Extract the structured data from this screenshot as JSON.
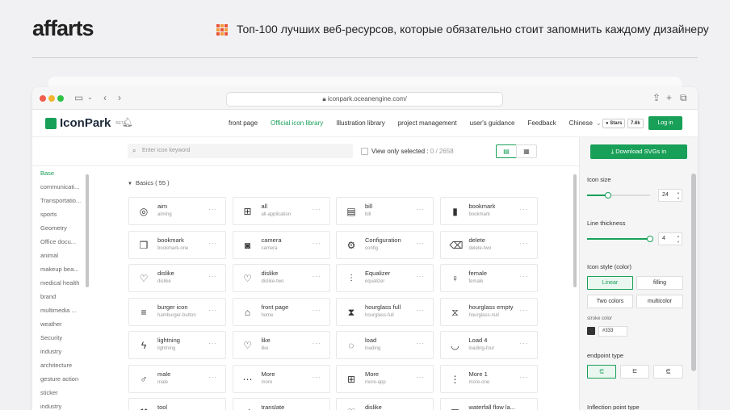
{
  "page": {
    "logo": "affarts",
    "headline": "Топ-100 лучших веб-ресурсов, которые обязательно стоит запомнить каждому дизайнеру"
  },
  "browser": {
    "url": "iconpark.oceanengine.com/"
  },
  "app": {
    "brand": "IconPark",
    "beta": "BETA",
    "nav": [
      "front page",
      "Official icon library",
      "Illustration library",
      "project management",
      "user's guidance",
      "Feedback",
      "Chinese"
    ],
    "active_nav": "Official icon library",
    "stars_label": "Stars",
    "stars_count": "7.6k",
    "login": "Log in"
  },
  "toolbar": {
    "search_placeholder": "Enter icon keyword",
    "view_only_label": "View only selected :",
    "view_only_count": "0 / 2658"
  },
  "sidebar": {
    "active": "Base",
    "items": [
      "Base",
      "communicati...",
      "Transportatio...",
      "sports",
      "Geometry",
      "Office docu...",
      "animal",
      "makeup bea...",
      "medical health",
      "brand",
      "multimedia ...",
      "weather",
      "Security",
      "industry",
      "architecture",
      "gesture action",
      "sticker",
      "industry"
    ]
  },
  "main": {
    "section_title": "Basics ( 55 )",
    "cards": [
      {
        "name": "aim",
        "sub": "aiming",
        "icon": "aim-icon",
        "glyph": "◎"
      },
      {
        "name": "all",
        "sub": "all-application",
        "icon": "all-application-icon",
        "glyph": "⊞"
      },
      {
        "name": "bill",
        "sub": "bill",
        "icon": "bill-icon",
        "glyph": "▤"
      },
      {
        "name": "bookmark",
        "sub": "bookmark",
        "icon": "bookmark-icon",
        "glyph": "▮"
      },
      {
        "name": "bookmark",
        "sub": "bookmark-one",
        "icon": "bookmark-one-icon",
        "glyph": "❒"
      },
      {
        "name": "camera",
        "sub": "camera",
        "icon": "camera-icon",
        "glyph": "◙"
      },
      {
        "name": "Configuration",
        "sub": "config",
        "icon": "config-icon",
        "glyph": "⚙"
      },
      {
        "name": "delete",
        "sub": "delete-two",
        "icon": "delete-icon",
        "glyph": "⌫"
      },
      {
        "name": "dislike",
        "sub": "dislike",
        "icon": "dislike-icon",
        "glyph": "♡"
      },
      {
        "name": "dislike",
        "sub": "dislike-two",
        "icon": "dislike-two-icon",
        "glyph": "♡"
      },
      {
        "name": "Equalizer",
        "sub": "equalizer",
        "icon": "equalizer-icon",
        "glyph": "⫶"
      },
      {
        "name": "female",
        "sub": "female",
        "icon": "female-icon",
        "glyph": "♀"
      },
      {
        "name": "burger icon",
        "sub": "hamburger-button",
        "icon": "hamburger-icon",
        "glyph": "≡"
      },
      {
        "name": "front page",
        "sub": "home",
        "icon": "home-icon",
        "glyph": "⌂"
      },
      {
        "name": "hourglass full",
        "sub": "hourglass-full",
        "icon": "hourglass-full-icon",
        "glyph": "⧗"
      },
      {
        "name": "hourglass empty",
        "sub": "hourglass-null",
        "icon": "hourglass-empty-icon",
        "glyph": "⧖"
      },
      {
        "name": "lightning",
        "sub": "lightning",
        "icon": "lightning-icon",
        "glyph": "ϟ"
      },
      {
        "name": "like",
        "sub": "like",
        "icon": "like-icon",
        "glyph": "♡"
      },
      {
        "name": "load",
        "sub": "loading",
        "icon": "loading-icon",
        "glyph": "◌"
      },
      {
        "name": "Load 4",
        "sub": "loading-four",
        "icon": "loading-four-icon",
        "glyph": "◡"
      },
      {
        "name": "male",
        "sub": "male",
        "icon": "male-icon",
        "glyph": "♂"
      },
      {
        "name": "More",
        "sub": "more",
        "icon": "more-icon",
        "glyph": "⋯"
      },
      {
        "name": "More",
        "sub": "more-app",
        "icon": "more-app-icon",
        "glyph": "⊞"
      },
      {
        "name": "More 1",
        "sub": "more-one",
        "icon": "more-one-icon",
        "glyph": "⋮"
      },
      {
        "name": "tool",
        "sub": "",
        "icon": "tool-icon",
        "glyph": "⚒"
      },
      {
        "name": "translate",
        "sub": "",
        "icon": "translate-icon",
        "glyph": "⇄"
      },
      {
        "name": "dislike",
        "sub": "",
        "icon": "dislike-three-icon",
        "glyph": "♡"
      },
      {
        "name": "waterfall flow la...",
        "sub": "",
        "icon": "waterfall-icon",
        "glyph": "▦"
      }
    ]
  },
  "panel": {
    "download": "Download SVGs in",
    "icon_size_label": "Icon size",
    "icon_size": "24",
    "icon_size_level": 0.33,
    "thickness_label": "Line thickness",
    "thickness": "4",
    "thickness_level": 1.0,
    "style_label": "Icon style (color)",
    "styles": [
      "Linear",
      "filling",
      "Two colors",
      "multicolor"
    ],
    "selected_style": "Linear",
    "stroke_label": "stroke color",
    "stroke_color": "#333",
    "endpoint_label": "endpoint type",
    "inflection_label": "Inflection point type"
  },
  "colors": {
    "accent": "#18a058",
    "brand_orange": "#e8553a"
  }
}
